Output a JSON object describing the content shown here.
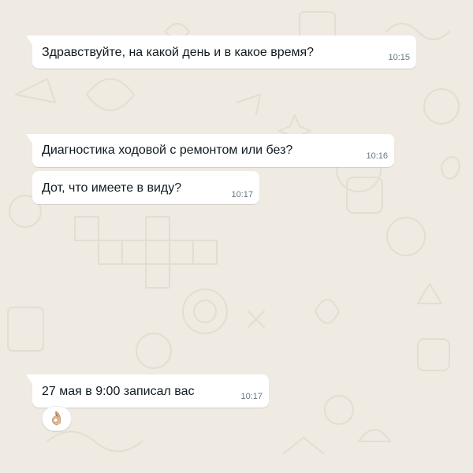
{
  "messages": [
    {
      "text": "Здравствуйте, на какой день и в какое время?",
      "time": "10:15"
    },
    {
      "text": "Диагностика ходовой с ремонтом или без?",
      "time": "10:16"
    },
    {
      "text": "Дот, что имеете в виду?",
      "time": "10:17"
    },
    {
      "text": "27 мая в 9:00 записал вас",
      "time": "10:17",
      "reaction": "👌🏼"
    }
  ],
  "colors": {
    "background": "#efeae2",
    "bubble": "#ffffff",
    "text": "#111b21",
    "meta": "#667781",
    "doodle": "#e3ddd3"
  }
}
